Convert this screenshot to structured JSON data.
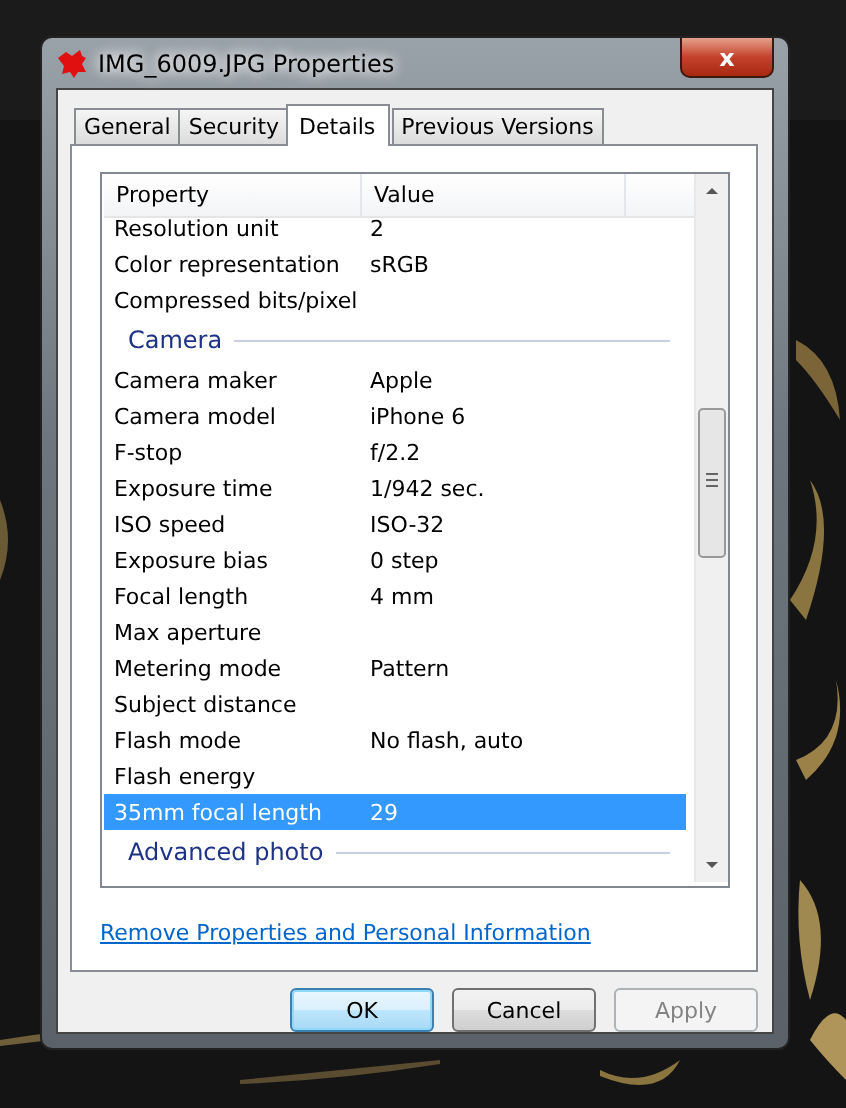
{
  "window": {
    "title": "IMG_6009.JPG Properties",
    "close": "x"
  },
  "tabs": [
    {
      "label": "General",
      "selected": false
    },
    {
      "label": "Security",
      "selected": false
    },
    {
      "label": "Details",
      "selected": true
    },
    {
      "label": "Previous Versions",
      "selected": false
    }
  ],
  "details": {
    "columns": [
      "Property",
      "Value"
    ],
    "rows": [
      {
        "kind": "row",
        "property": "Resolution unit",
        "value": "2",
        "selected": false
      },
      {
        "kind": "row",
        "property": "Color representation",
        "value": "sRGB",
        "selected": false
      },
      {
        "kind": "row",
        "property": "Compressed bits/pixel",
        "value": "",
        "selected": false
      },
      {
        "kind": "group",
        "title": "Camera"
      },
      {
        "kind": "row",
        "property": "Camera maker",
        "value": "Apple",
        "selected": false
      },
      {
        "kind": "row",
        "property": "Camera model",
        "value": "iPhone 6",
        "selected": false
      },
      {
        "kind": "row",
        "property": "F-stop",
        "value": "f/2.2",
        "selected": false
      },
      {
        "kind": "row",
        "property": "Exposure time",
        "value": "1/942 sec.",
        "selected": false
      },
      {
        "kind": "row",
        "property": "ISO speed",
        "value": "ISO-32",
        "selected": false
      },
      {
        "kind": "row",
        "property": "Exposure bias",
        "value": "0 step",
        "selected": false
      },
      {
        "kind": "row",
        "property": "Focal length",
        "value": "4 mm",
        "selected": false
      },
      {
        "kind": "row",
        "property": "Max aperture",
        "value": "",
        "selected": false
      },
      {
        "kind": "row",
        "property": "Metering mode",
        "value": "Pattern",
        "selected": false
      },
      {
        "kind": "row",
        "property": "Subject distance",
        "value": "",
        "selected": false
      },
      {
        "kind": "row",
        "property": "Flash mode",
        "value": "No flash, auto",
        "selected": false
      },
      {
        "kind": "row",
        "property": "Flash energy",
        "value": "",
        "selected": false
      },
      {
        "kind": "row",
        "property": "35mm focal length",
        "value": "29",
        "selected": true
      },
      {
        "kind": "group",
        "title": "Advanced photo"
      }
    ]
  },
  "link": "Remove Properties and Personal Information",
  "buttons": [
    {
      "label": "OK",
      "kind": "default",
      "disabled": false
    },
    {
      "label": "Cancel",
      "kind": "normal",
      "disabled": false
    },
    {
      "label": "Apply",
      "kind": "normal",
      "disabled": true
    }
  ]
}
